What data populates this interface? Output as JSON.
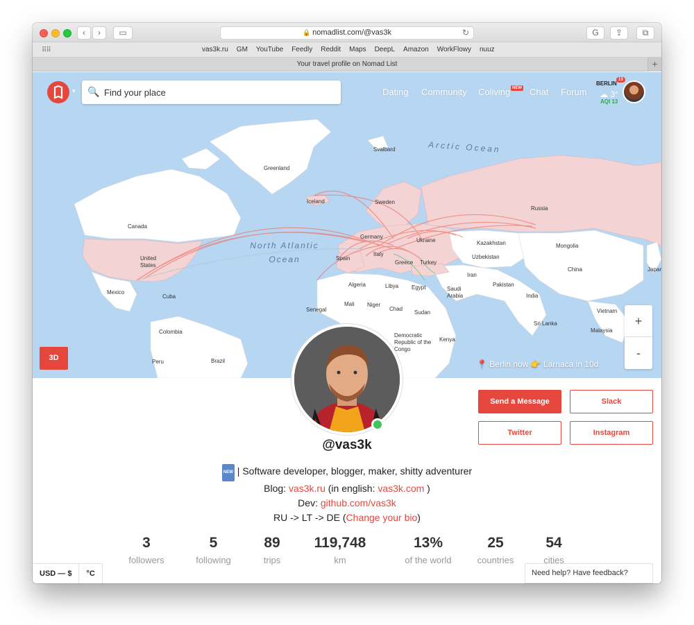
{
  "browser": {
    "url": "nomadlist.com/@vas3k",
    "bookmarks": [
      "vas3k.ru",
      "GM",
      "YouTube",
      "Feedly",
      "Reddit",
      "Maps",
      "DeepL",
      "Amazon",
      "WorkFlowy",
      "nuuz"
    ],
    "tab_title": "Your travel profile on Nomad List"
  },
  "header": {
    "search_placeholder": "Find your place",
    "nav": [
      "Dating",
      "Community",
      "Coliving",
      "Chat",
      "Forum"
    ],
    "new_badge": "NEW",
    "weather": {
      "city": "BERLIN",
      "temp": "3°",
      "aqi": "AQI 13",
      "notifications": "13"
    }
  },
  "map": {
    "ocean_labels": [
      "North Atlantic Ocean",
      "Arctic Ocean"
    ],
    "labels": [
      "Greenland",
      "Canada",
      "United States",
      "Mexico",
      "Cuba",
      "Iceland",
      "Svalbard",
      "Sweden",
      "Russia",
      "Germany",
      "Ukraine",
      "Spain",
      "Italy",
      "Greece",
      "Turkey",
      "Kazakhstan",
      "Mongolia",
      "Uzbekistan",
      "China",
      "Iran",
      "Pakistan",
      "India",
      "Japan",
      "Algeria",
      "Libya",
      "Egypt",
      "Saudi Arabia",
      "Mali",
      "Niger",
      "Chad",
      "Sudan",
      "Senegal",
      "Kenya",
      "Democratic Republic of the Congo",
      "Colombia",
      "Peru",
      "Brazil",
      "Vietnam",
      "Sri Lanka",
      "Malaysia"
    ],
    "btn_3d": "3D",
    "zoom_in": "+",
    "zoom_out": "-",
    "location_now": "📍 Berlin now 👉 Larnaca in 10d"
  },
  "profile": {
    "username": "@vas3k",
    "bio_tag": "NEW",
    "bio_line1": " | Software developer, blogger, maker, shitty adventurer",
    "blog_prefix": "Blog: ",
    "blog_link": "vas3k.ru",
    "blog_mid": " (in english: ",
    "blog_link2": "vas3k.com",
    "blog_end": " )",
    "dev_prefix": "Dev: ",
    "dev_link": "github.com/vas3k",
    "route": "RU -> LT -> DE  (",
    "change_bio": "Change your bio",
    "route_end": ")",
    "buttons": {
      "message": "Send a Message",
      "slack": "Slack",
      "twitter": "Twitter",
      "instagram": "Instagram"
    },
    "stats": [
      {
        "value": "3",
        "label": "followers"
      },
      {
        "value": "5",
        "label": "following"
      },
      {
        "value": "89",
        "label": "trips"
      },
      {
        "value": "119,748",
        "label": "km"
      },
      {
        "value": "13%",
        "label": "of the world"
      },
      {
        "value": "25",
        "label": "countries"
      },
      {
        "value": "54",
        "label": "cities"
      }
    ]
  },
  "footer": {
    "currency": "USD — $",
    "unit": "°C",
    "help": "Need help? Have feedback?"
  },
  "colors": {
    "accent": "#e5473d",
    "ocean": "#b6d6f2",
    "land": "#ffffff",
    "visited": "#f3d3d3",
    "online": "#3fc55a"
  }
}
